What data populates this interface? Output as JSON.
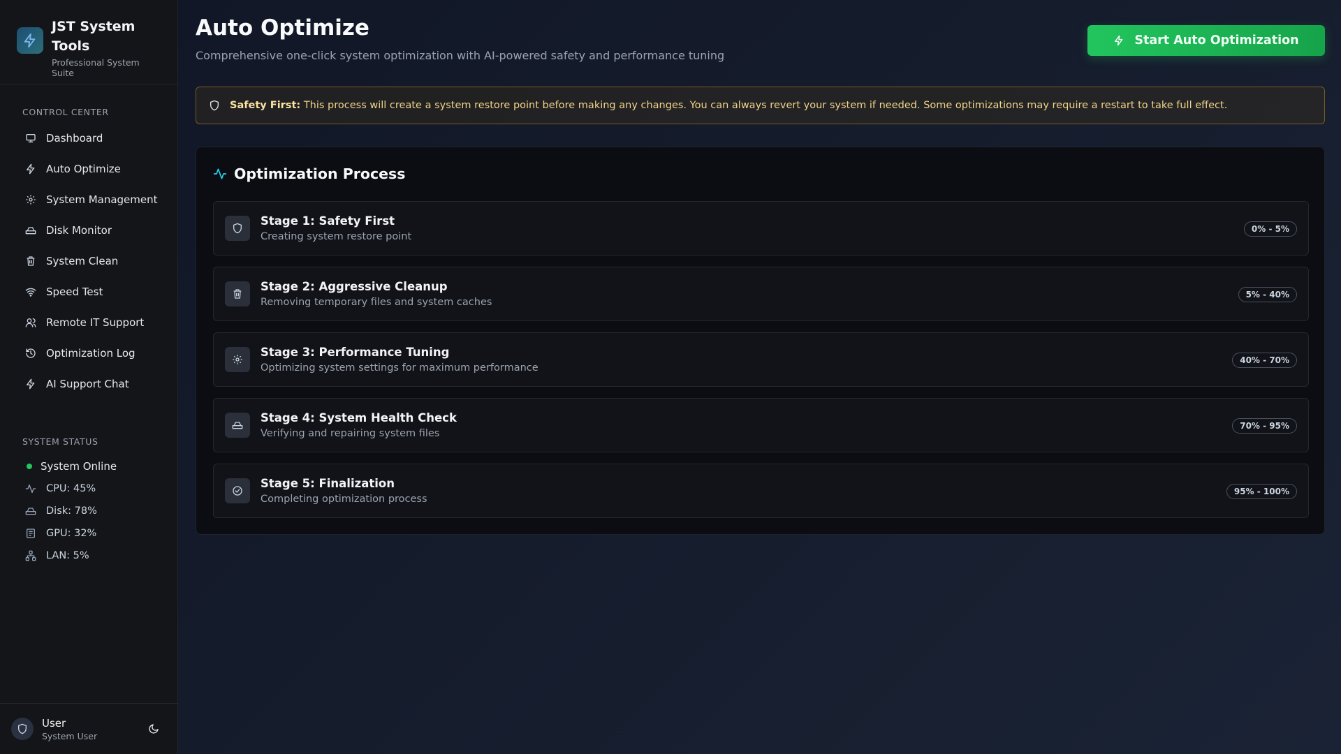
{
  "brand": {
    "title": "JST System Tools",
    "subtitle": "Professional System Suite"
  },
  "nav": {
    "section_label": "Control Center",
    "items": [
      {
        "label": "Dashboard",
        "icon": "monitor-icon"
      },
      {
        "label": "Auto Optimize",
        "icon": "lightning-icon"
      },
      {
        "label": "System Management",
        "icon": "gear-icon"
      },
      {
        "label": "Disk Monitor",
        "icon": "hard-drive-icon"
      },
      {
        "label": "System Clean",
        "icon": "trash-icon"
      },
      {
        "label": "Speed Test",
        "icon": "wifi-icon"
      },
      {
        "label": "Remote IT Support",
        "icon": "users-icon"
      },
      {
        "label": "Optimization Log",
        "icon": "history-icon"
      },
      {
        "label": "AI Support Chat",
        "icon": "lightning-icon"
      }
    ]
  },
  "status": {
    "section_label": "System Status",
    "online": "System Online",
    "cpu": "CPU: 45%",
    "disk": "Disk: 78%",
    "gpu": "GPU: 32%",
    "lan": "LAN: 5%"
  },
  "user": {
    "name": "User",
    "role": "System User"
  },
  "header": {
    "title": "Auto Optimize",
    "subtitle": "Comprehensive one-click system optimization with AI-powered safety and performance tuning",
    "start_button": "Start Auto Optimization"
  },
  "alert": {
    "strong": "Safety First:",
    "text": "This process will create a system restore point before making any changes. You can always revert your system if needed. Some optimizations may require a restart to take full effect."
  },
  "process": {
    "title": "Optimization Process",
    "stages": [
      {
        "title": "Stage 1: Safety First",
        "desc": "Creating system restore point",
        "range": "0% - 5%",
        "icon": "shield-icon"
      },
      {
        "title": "Stage 2: Aggressive Cleanup",
        "desc": "Removing temporary files and system caches",
        "range": "5% - 40%",
        "icon": "trash-icon"
      },
      {
        "title": "Stage 3: Performance Tuning",
        "desc": "Optimizing system settings for maximum performance",
        "range": "40% - 70%",
        "icon": "gear-icon"
      },
      {
        "title": "Stage 4: System Health Check",
        "desc": "Verifying and repairing system files",
        "range": "70% - 95%",
        "icon": "hard-drive-icon"
      },
      {
        "title": "Stage 5: Finalization",
        "desc": "Completing optimization process",
        "range": "95% - 100%",
        "icon": "check-circle-icon"
      }
    ]
  },
  "colors": {
    "accent_green": "#22c55e",
    "warning": "#f2d48a",
    "activity": "#22d3ee"
  }
}
